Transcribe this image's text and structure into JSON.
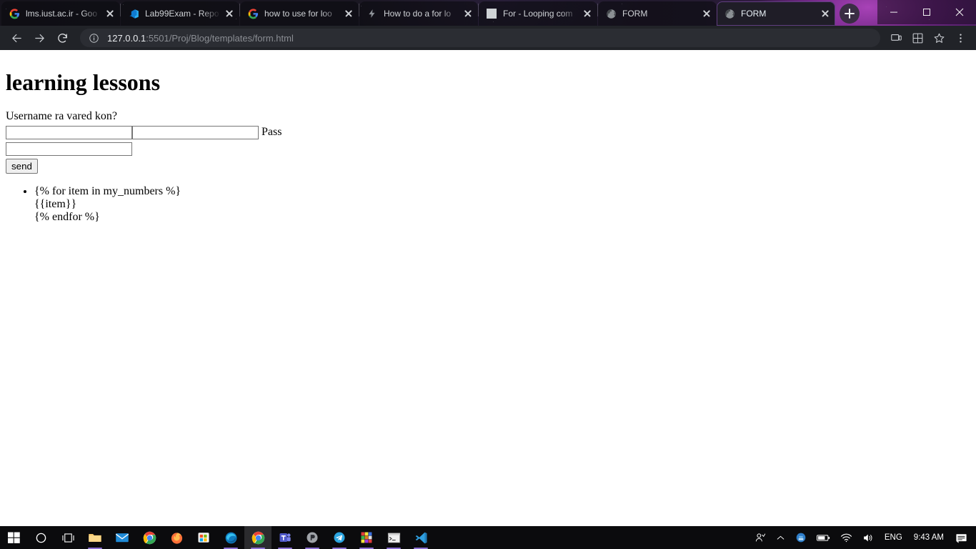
{
  "browser": {
    "tabs": [
      {
        "title": "lms.iust.ac.ir - Goo",
        "favicon": "google-icon",
        "active": false
      },
      {
        "title": "Lab99Exam - Repo",
        "favicon": "azure-devops-icon",
        "active": false
      },
      {
        "title": "how to use for loo",
        "favicon": "google-icon",
        "active": false
      },
      {
        "title": "How to do a for lo",
        "favicon": "lightning-icon",
        "active": false
      },
      {
        "title": "For - Looping com",
        "favicon": "blank-page-icon",
        "active": false
      },
      {
        "title": "FORM",
        "favicon": "globe-icon",
        "active": false
      },
      {
        "title": "FORM",
        "favicon": "globe-icon",
        "active": true
      }
    ],
    "new_tab_label": "New Tab",
    "window_controls": {
      "minimize": "minimize-icon",
      "maximize": "maximize-icon",
      "close": "close-icon"
    },
    "toolbar": {
      "back": "back-arrow-icon",
      "forward": "forward-arrow-icon",
      "reload": "reload-icon",
      "site_info": "info-circle-icon",
      "url_host": "127.0.0.1",
      "url_path": ":5501/Proj/Blog/templates/form.html",
      "url_full": "127.0.0.1:5501/Proj/Blog/templates/form.html",
      "cast": "cast-icon",
      "extensions": "extensions-puzzle-icon",
      "bookmark": "star-icon",
      "menu": "three-dot-menu-icon"
    }
  },
  "page": {
    "title": "learning lessons",
    "form": {
      "label": "Username ra vared kon?",
      "username_value": "",
      "username_placeholder": "",
      "pass_top_value": "",
      "pass_top_placeholder": "",
      "pass_label": "Pass",
      "password_value": "",
      "password_placeholder": "",
      "submit_label": "send"
    },
    "template_block": {
      "for_line": "{% for item in my_numbers %}",
      "item_line": "{{item}}",
      "endfor_line": "{% endfor %}"
    }
  },
  "taskbar": {
    "items": [
      {
        "name": "start-button",
        "icon": "windows-logo-icon"
      },
      {
        "name": "search-button",
        "icon": "search-circle-icon"
      },
      {
        "name": "task-view-button",
        "icon": "task-view-icon"
      },
      {
        "name": "file-explorer",
        "icon": "folder-icon"
      },
      {
        "name": "mail-app",
        "icon": "mail-icon"
      },
      {
        "name": "chrome-app",
        "icon": "chrome-icon"
      },
      {
        "name": "firefox-app",
        "icon": "firefox-icon"
      },
      {
        "name": "microsoft-store",
        "icon": "store-icon"
      },
      {
        "name": "edge-app",
        "icon": "edge-icon"
      },
      {
        "name": "chrome-window",
        "icon": "chrome-icon"
      },
      {
        "name": "teams-app",
        "icon": "teams-icon"
      },
      {
        "name": "p-app",
        "icon": "p-circle-icon"
      },
      {
        "name": "telegram-app",
        "icon": "telegram-icon"
      },
      {
        "name": "rubik-app",
        "icon": "colorful-grid-icon"
      },
      {
        "name": "command-prompt",
        "icon": "terminal-icon"
      },
      {
        "name": "vscode-app",
        "icon": "vscode-icon"
      }
    ],
    "tray": {
      "people": "people-icon",
      "show_hidden": "chevron-up-icon",
      "onedrive": "blue-circle-icon",
      "battery": "battery-icon",
      "wifi": "wifi-icon",
      "volume": "speaker-icon",
      "language": "ENG",
      "clock": "9:43 AM",
      "notifications": "notification-icon"
    }
  },
  "colors": {
    "tab_strip_accent": "#5b2573",
    "toolbar_bg": "#212328",
    "omnibox_bg": "#2b2d33",
    "page_bg": "#ffffff",
    "taskbar_bg": "#0b0b0d",
    "taskbar_indicator": "#8a6fd1"
  }
}
